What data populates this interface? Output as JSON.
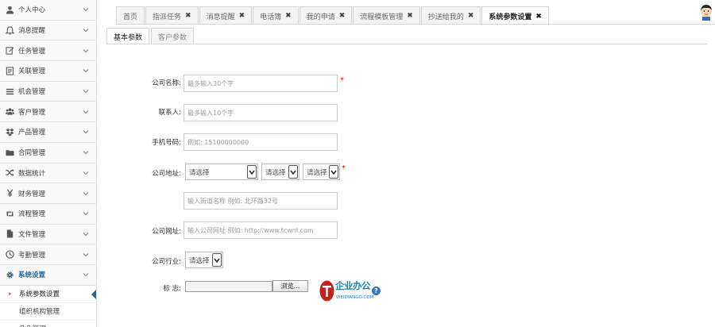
{
  "sidebar": {
    "items": [
      {
        "label": "个人中心",
        "icon": "user-icon"
      },
      {
        "label": "消息提醒",
        "icon": "bell-icon"
      },
      {
        "label": "任务管理",
        "icon": "edit-icon"
      },
      {
        "label": "关联管理",
        "icon": "document-icon"
      },
      {
        "label": "机会管理",
        "icon": "list-icon"
      },
      {
        "label": "客户管理",
        "icon": "group-icon"
      },
      {
        "label": "产品管理",
        "icon": "dropbox-icon"
      },
      {
        "label": "合同管理",
        "icon": "folder-icon"
      },
      {
        "label": "数据统计",
        "icon": "shuffle-icon"
      },
      {
        "label": "财务管理",
        "icon": "yen-icon"
      },
      {
        "label": "流程管理",
        "icon": "retweet-icon"
      },
      {
        "label": "文件管理",
        "icon": "file-icon"
      },
      {
        "label": "考勤管理",
        "icon": "clock-icon"
      },
      {
        "label": "系统设置",
        "icon": "gear-icon",
        "active": true
      }
    ],
    "sub_items": [
      {
        "label": "系统参数设置",
        "current": true
      },
      {
        "label": "组织机构管理"
      },
      {
        "label": "角色管理"
      }
    ]
  },
  "tabs": [
    {
      "label": "首页",
      "closable": false
    },
    {
      "label": "指派任务",
      "closable": true
    },
    {
      "label": "消息提醒",
      "closable": true
    },
    {
      "label": "电话簿",
      "closable": true
    },
    {
      "label": "我的申请",
      "closable": true
    },
    {
      "label": "流程模板管理",
      "closable": true
    },
    {
      "label": "抄送给我的",
      "closable": true
    },
    {
      "label": "系统参数设置",
      "closable": true,
      "active": true
    }
  ],
  "subtabs": [
    {
      "label": "基本参数",
      "active": true
    },
    {
      "label": "客户参数"
    }
  ],
  "form": {
    "company_name": {
      "label": "公司名称:",
      "placeholder": "最多输入30个字",
      "required": "*"
    },
    "contact": {
      "label": "联系人:",
      "placeholder": "最多输入10个字"
    },
    "phone": {
      "label": "手机号码:",
      "placeholder": "例如: 15100000000"
    },
    "address": {
      "label": "公司地址:",
      "province": "请选择",
      "city": "请选择",
      "district": "请选择",
      "required": "*",
      "street_placeholder": "输入街道名称 例如: 北环路32号"
    },
    "website": {
      "label": "公司网址:",
      "placeholder": "输入公司网址 例如: http://www.tcwnl.com"
    },
    "industry": {
      "label": "公司行业:",
      "value": "请选择"
    },
    "logo": {
      "label": "标  志:",
      "browse_label": "浏览..."
    }
  },
  "brand": {
    "name": "企业办公",
    "sub": "WEIDIANGO.COM",
    "color": "#1e7fb8",
    "mark_color": "#c0221e"
  }
}
